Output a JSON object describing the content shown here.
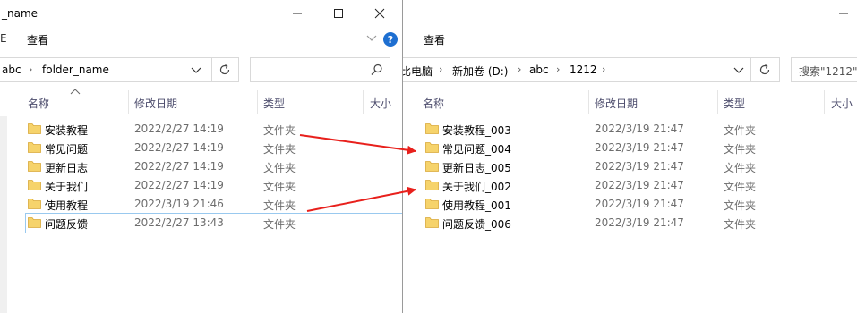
{
  "left": {
    "title": "_name",
    "controls": {
      "minimize": "—",
      "maximize": "☐",
      "close": "✕"
    },
    "menu": {
      "stub": "E",
      "view": "查看"
    },
    "breadcrumb": [
      "abc",
      "folder_name"
    ],
    "columns": {
      "name": "名称",
      "date": "修改日期",
      "type": "类型",
      "size": "大小"
    },
    "rows": [
      {
        "name": "安装教程",
        "date": "2022/2/27 14:19",
        "type": "文件夹"
      },
      {
        "name": "常见问题",
        "date": "2022/2/27 14:19",
        "type": "文件夹"
      },
      {
        "name": "更新日志",
        "date": "2022/2/27 14:19",
        "type": "文件夹"
      },
      {
        "name": "关于我们",
        "date": "2022/2/27 14:19",
        "type": "文件夹"
      },
      {
        "name": "使用教程",
        "date": "2022/3/19 21:46",
        "type": "文件夹"
      },
      {
        "name": "问题反馈",
        "date": "2022/2/27 13:43",
        "type": "文件夹"
      }
    ]
  },
  "right": {
    "menu": {
      "view": "查看"
    },
    "breadcrumb": [
      "比电脑",
      "新加卷 (D:)",
      "abc",
      "1212"
    ],
    "search_placeholder": "搜索\"1212\"",
    "columns": {
      "name": "名称",
      "date": "修改日期",
      "type": "类型",
      "size": "大小"
    },
    "rows": [
      {
        "name": "安装教程_003",
        "date": "2022/3/19 21:47",
        "type": "文件夹"
      },
      {
        "name": "常见问题_004",
        "date": "2022/3/19 21:47",
        "type": "文件夹"
      },
      {
        "name": "更新日志_005",
        "date": "2022/3/19 21:47",
        "type": "文件夹"
      },
      {
        "name": "关于我们_002",
        "date": "2022/3/19 21:47",
        "type": "文件夹"
      },
      {
        "name": "使用教程_001",
        "date": "2022/3/19 21:47",
        "type": "文件夹"
      },
      {
        "name": "问题反馈_006",
        "date": "2022/3/19 21:47",
        "type": "文件夹"
      }
    ]
  },
  "colors": {
    "folder": "#f6d36b",
    "arrow": "#e8201c",
    "help": "#1e6fd1"
  }
}
